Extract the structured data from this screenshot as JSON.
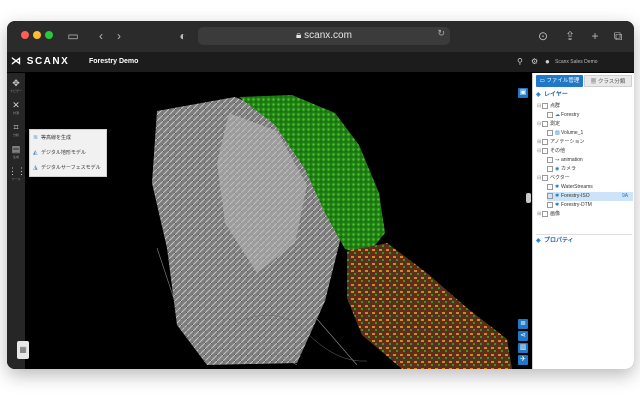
{
  "browser": {
    "url": "scanx.com"
  },
  "app": {
    "logo": "SCANX",
    "project": "Forestry Demo",
    "user": "Scanx Sales Demo"
  },
  "toolbar": {
    "items": [
      {
        "label": "ナビゲー"
      },
      {
        "label": "計測"
      },
      {
        "label": "分析"
      },
      {
        "label": "生成"
      },
      {
        "label": "ツール"
      }
    ]
  },
  "flyout": {
    "items": [
      {
        "label": "等高線を生成",
        "icon": "contour-icon"
      },
      {
        "label": "デジタル地形モデル",
        "icon": "dtm-icon"
      },
      {
        "label": "デジタルサーフェスモデル",
        "icon": "dsm-icon"
      }
    ]
  },
  "panel": {
    "tabs": [
      {
        "label": "ファイル管理"
      },
      {
        "label": "クラス分類"
      }
    ],
    "layers_title": "レイヤー",
    "properties_title": "プロパティ",
    "tree": [
      {
        "label": "点群",
        "level": 0
      },
      {
        "label": "Forestry",
        "level": 1
      },
      {
        "label": "測定",
        "level": 0
      },
      {
        "label": "Volume_1",
        "level": 1
      },
      {
        "label": "アノテーション",
        "level": 0
      },
      {
        "label": "その他",
        "level": 0
      },
      {
        "label": "animation",
        "level": 1
      },
      {
        "label": "カメラ",
        "level": 1
      },
      {
        "label": "ベクター",
        "level": 0
      },
      {
        "label": "WaterStreams",
        "level": 1
      },
      {
        "label": "Forestry-ISO",
        "level": 1,
        "tag": "9A"
      },
      {
        "label": "Forestry-DTM",
        "level": 1
      },
      {
        "label": "画像",
        "level": 0
      }
    ]
  },
  "colors": {
    "accent": "#1f78c8",
    "terrain_gray": "#9a9a9a",
    "vegetation": "#2e9d1a",
    "contour_orange": "#d9851c",
    "buildings_brown": "#6e3b24"
  }
}
